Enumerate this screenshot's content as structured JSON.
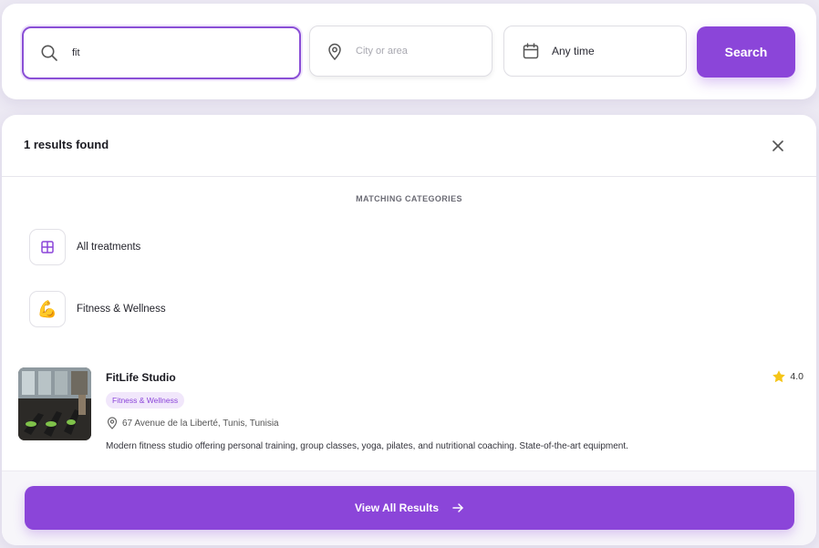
{
  "search": {
    "query_value": "fit",
    "location_placeholder": "City or area",
    "date_label": "Any time",
    "button_label": "Search"
  },
  "results": {
    "count_label": "1 results found",
    "categories_heading": "MATCHING CATEGORIES",
    "categories": [
      {
        "label": "All treatments",
        "icon": "grid-icon"
      },
      {
        "label": "Fitness & Wellness",
        "icon": "flexed-biceps-icon",
        "emoji": "💪"
      }
    ],
    "items": [
      {
        "title": "FitLife Studio",
        "tag": "Fitness & Wellness",
        "address": "67 Avenue de la Liberté, Tunis, Tunisia",
        "description": "Modern fitness studio offering personal training, group classes, yoga, pilates, and nutritional coaching. State-of-the-art equipment.",
        "rating": "4.0"
      }
    ],
    "view_all_label": "View All Results"
  },
  "colors": {
    "accent": "#8b45d9",
    "tag_bg": "#f1e7fb",
    "star": "#f5c518"
  }
}
